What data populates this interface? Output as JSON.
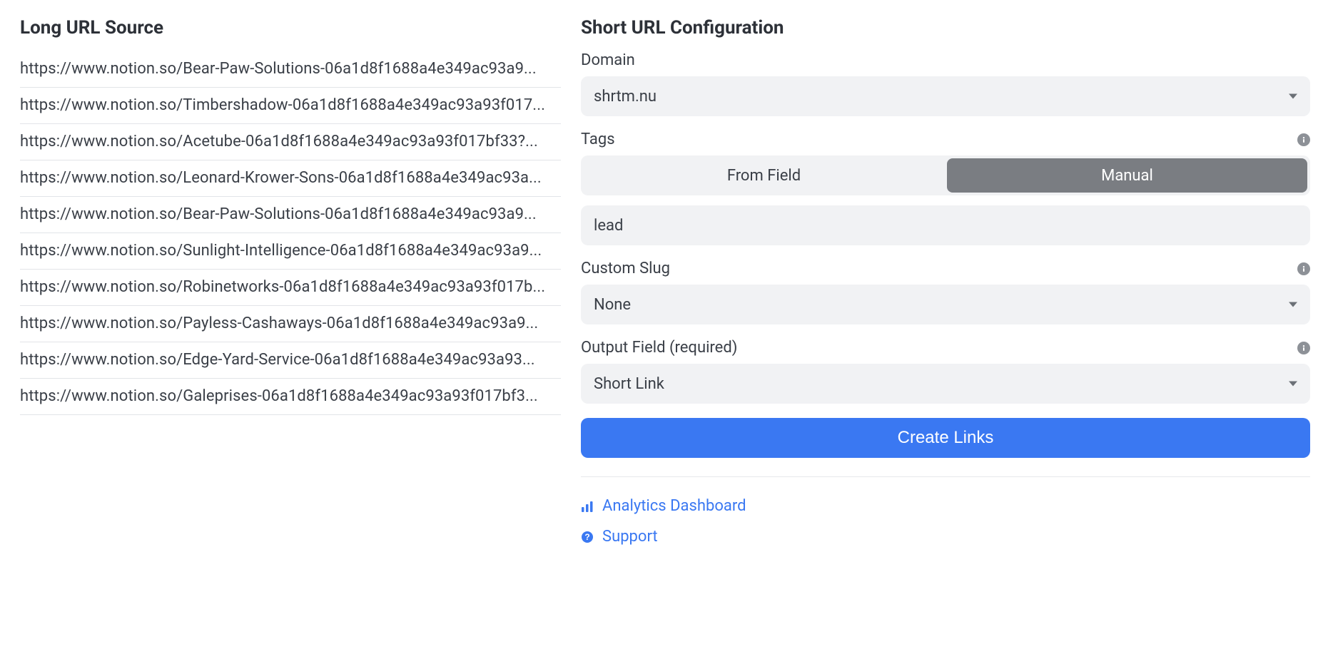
{
  "left": {
    "title": "Long URL Source",
    "urls": [
      "https://www.notion.so/Bear-Paw-Solutions-06a1d8f1688a4e349ac93a9...",
      "https://www.notion.so/Timbershadow-06a1d8f1688a4e349ac93a93f017...",
      "https://www.notion.so/Acetube-06a1d8f1688a4e349ac93a93f017bf33?...",
      "https://www.notion.so/Leonard-Krower-Sons-06a1d8f1688a4e349ac93a...",
      "https://www.notion.so/Bear-Paw-Solutions-06a1d8f1688a4e349ac93a9...",
      "https://www.notion.so/Sunlight-Intelligence-06a1d8f1688a4e349ac93a9...",
      "https://www.notion.so/Robinetworks-06a1d8f1688a4e349ac93a93f017b...",
      "https://www.notion.so/Payless-Cashaways-06a1d8f1688a4e349ac93a9...",
      "https://www.notion.so/Edge-Yard-Service-06a1d8f1688a4e349ac93a93...",
      "https://www.notion.so/Galeprises-06a1d8f1688a4e349ac93a93f017bf3..."
    ]
  },
  "right": {
    "title": "Short URL Configuration",
    "domain": {
      "label": "Domain",
      "value": "shrtm.nu"
    },
    "tags": {
      "label": "Tags",
      "segment_from_field": "From Field",
      "segment_manual": "Manual",
      "active_segment": "manual",
      "value": "lead"
    },
    "slug": {
      "label": "Custom Slug",
      "value": "None"
    },
    "output": {
      "label": "Output Field (required)",
      "value": "Short Link"
    },
    "create_button": "Create Links",
    "links": {
      "analytics": "Analytics Dashboard",
      "support": "Support"
    }
  }
}
